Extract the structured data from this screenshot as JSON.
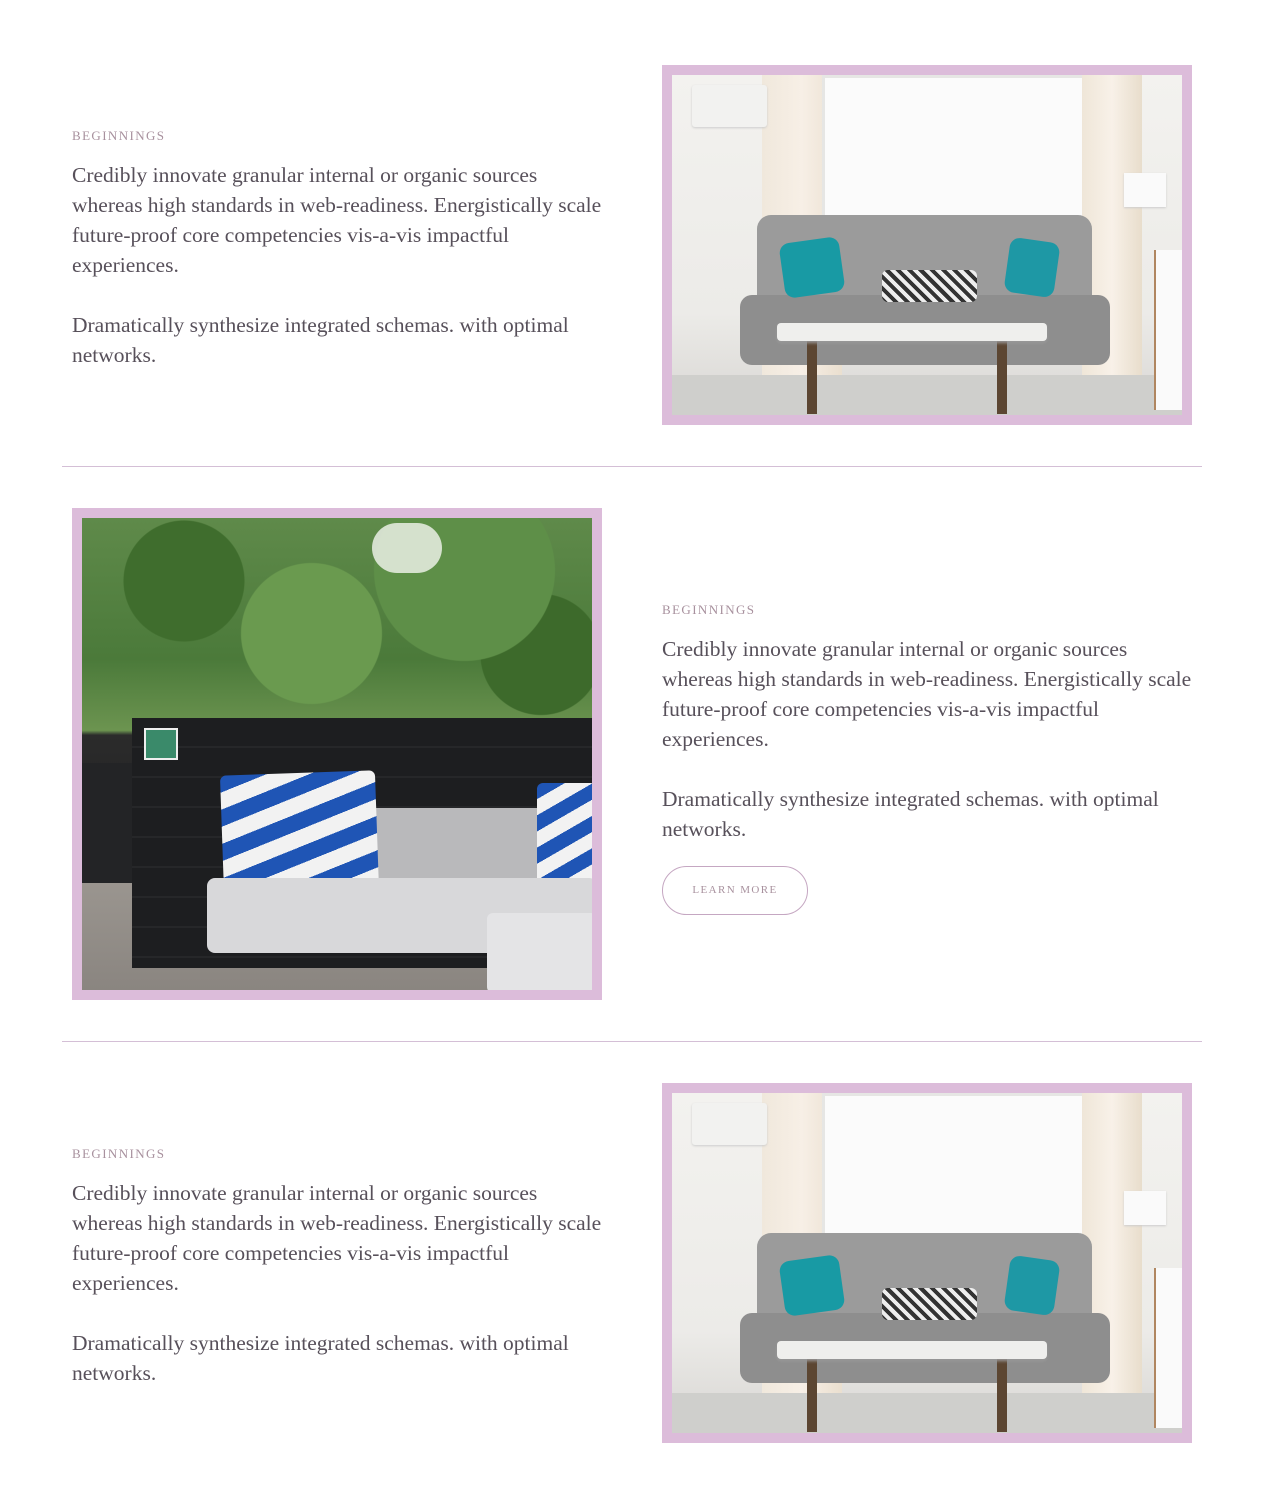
{
  "sections": [
    {
      "eyebrow": "BEGINNINGS",
      "paragraph1": "Credibly innovate granular internal or organic sources whereas high standards in web-readiness. Energistically scale future-proof core competencies vis-a-vis impactful experiences.",
      "paragraph2": "Dramatically synthesize integrated schemas. with optimal networks.",
      "image": "living-room-sofa-photo"
    },
    {
      "eyebrow": "BEGINNINGS",
      "paragraph1": "Credibly innovate granular internal or organic sources whereas high standards in web-readiness. Energistically scale future-proof core competencies vis-a-vis impactful experiences.",
      "paragraph2": "Dramatically synthesize integrated schemas. with optimal networks.",
      "button_label": "LEARN MORE",
      "image": "patio-sofa-photo"
    },
    {
      "eyebrow": "BEGINNINGS",
      "paragraph1": "Credibly innovate granular internal or organic sources whereas high standards in web-readiness. Energistically scale future-proof core competencies vis-a-vis impactful experiences.",
      "paragraph2": "Dramatically synthesize integrated schemas. with optimal networks.",
      "image": "living-room-sofa-photo"
    }
  ],
  "colors": {
    "frame": "#dcbcda",
    "divider": "#d4bfd6",
    "eyebrow": "#a8919e",
    "body_text": "#57505a"
  }
}
